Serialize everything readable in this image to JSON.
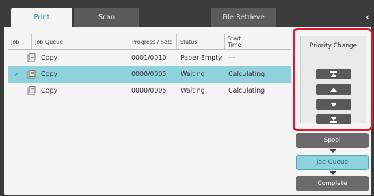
{
  "tabs": {
    "print": "Print",
    "scan": "Scan",
    "file_retrieve": "File Retrieve"
  },
  "table": {
    "headers": {
      "job": "Job",
      "job_queue": "Job Queue",
      "progress": "Progress / Sets",
      "status": "Status",
      "start_time_1": "Start",
      "start_time_2": "Time"
    },
    "rows": [
      {
        "name": "Copy",
        "progress": "0001/0010",
        "status": "Paper Empty",
        "time": "---"
      },
      {
        "name": "Copy",
        "progress": "0000/0005",
        "status": "Waiting",
        "time": "Calculating"
      },
      {
        "name": "Copy",
        "progress": "0000/0005",
        "status": "Waiting",
        "time": "Calculating"
      }
    ]
  },
  "priority": {
    "title": "Priority Change"
  },
  "queue_buttons": {
    "spool": "Spool",
    "job_queue": "Job Queue",
    "complete": "Complete"
  },
  "colors": {
    "highlight": "#8fd2de",
    "accent_red": "#e0192c",
    "tab_blue": "#2f8fc8"
  },
  "icons": [
    "copy-icon",
    "check-icon",
    "move-to-top-icon",
    "move-up-icon",
    "move-down-icon",
    "move-to-bottom-icon",
    "back-arrow-icon"
  ]
}
